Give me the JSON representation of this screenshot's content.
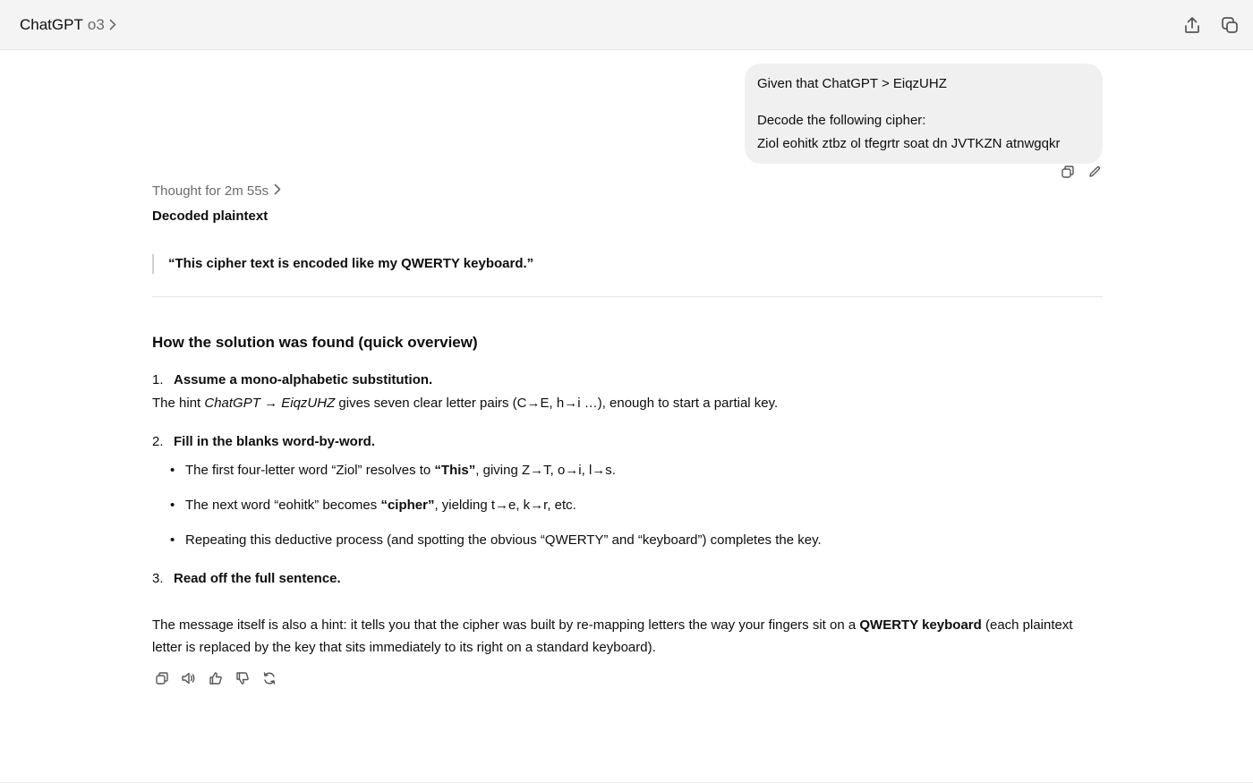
{
  "header": {
    "app_name": "ChatGPT",
    "model": "o3"
  },
  "user_message": {
    "line1": "Given that ChatGPT > EiqzUHZ",
    "line2": "Decode the following cipher:",
    "line3": "Ziol eohitk ztbz ol tfegrtr soat dn JVTKZN atnwgqkr"
  },
  "assistant": {
    "thought_label": "Thought for 2m 55s",
    "decoded_heading": "Decoded plaintext",
    "quote": "“This cipher text is encoded like my QWERTY keyboard.”",
    "overview_title": "How the solution was found (quick overview)",
    "step1": {
      "num": "1.",
      "title": "Assume a mono-alphabetic substitution.",
      "body_prefix": "The hint ",
      "body_em1": "ChatGPT",
      "body_arrow": " → ",
      "body_em2": "EiqzUHZ",
      "body_suffix": " gives seven clear letter pairs (C→E, h→i …), enough to start a partial key."
    },
    "step2": {
      "num": "2.",
      "title": "Fill in the blanks word-by-word.",
      "bullets": [
        {
          "prefix": "The first four-letter word “Ziol” resolves to ",
          "bold": "“This”",
          "suffix": ", giving Z→T, o→i, l→s."
        },
        {
          "prefix": "The next word “eohitk” becomes ",
          "bold": "“cipher”",
          "suffix": ", yielding t→e, k→r, etc."
        },
        {
          "prefix": "Repeating this deductive process (and spotting the obvious “QWERTY” and “keyboard”) completes the key.",
          "bold": "",
          "suffix": ""
        }
      ]
    },
    "step3": {
      "num": "3.",
      "title": "Read off the full sentence."
    },
    "closing": {
      "prefix": "The message itself is also a hint: it tells you that the cipher was built by re-mapping letters the way your fingers sit on a ",
      "bold": "QWERTY keyboard",
      "suffix": " (each plaintext letter is replaced by the key that sits immediately to its right on a standard keyboard)."
    }
  },
  "icons": {
    "share": "share-icon",
    "new_chat": "new-chat-icon",
    "copy": "copy-icon",
    "edit": "edit-icon",
    "read_aloud": "speaker-icon",
    "thumbs_up": "thumbs-up-icon",
    "thumbs_down": "thumbs-down-icon",
    "regenerate": "regenerate-icon"
  },
  "colors": {
    "topbar_bg": "#f4f4f4",
    "bubble_bg": "#f0f0f0",
    "muted_text": "#6b6b6b"
  }
}
